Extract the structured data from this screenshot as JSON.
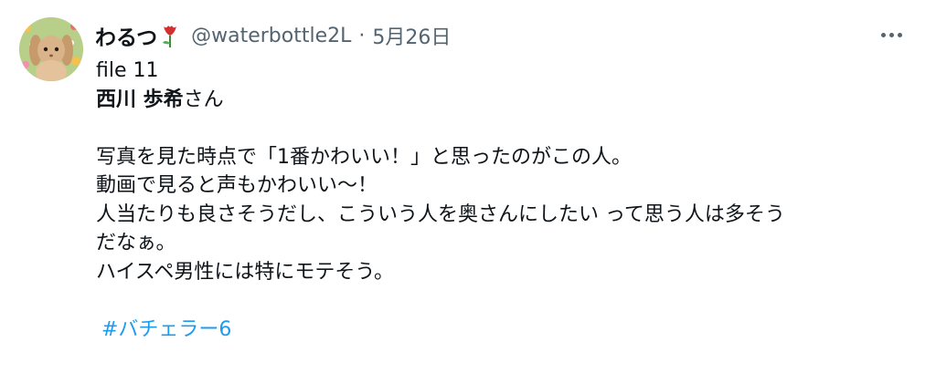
{
  "tweet": {
    "display_name": "わるつ",
    "name_emoji": "tulip-icon",
    "handle": "@waterbottle2L",
    "separator": "·",
    "date": "5月26日",
    "more_icon": "more-horizontal-icon",
    "lines": {
      "file": "file 11",
      "person_bold": "西川 歩希",
      "person_suffix": "さん",
      "line1": "写真を見た時点で「1番かわいい！」と思ったのがこの人。",
      "line2": "動画で見ると声もかわいい〜！",
      "line3": "人当たりも良さそうだし、こういう人を奥さんにしたい って思う人は多そう",
      "line4": "だなぁ。",
      "line5": "ハイスペ男性には特にモテそう。"
    },
    "hashtag": "#バチェラー6"
  },
  "colors": {
    "text": "#0f1419",
    "secondary": "#536471",
    "link": "#1d9bf0"
  }
}
